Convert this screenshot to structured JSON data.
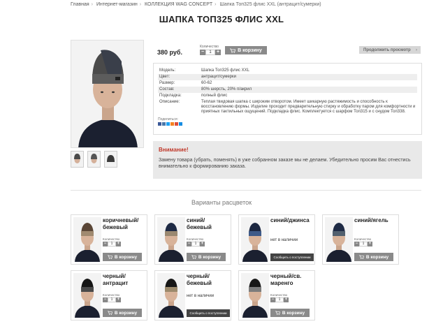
{
  "breadcrumb": [
    "Главная",
    "Интернет-магазин",
    "КОЛЛЕКЦИЯ WAG CONCEPT",
    "Шапка Топ325 флис XXL (антрацит/сумерки)"
  ],
  "title": "ШАПКА ТОП325 ФЛИС XXL",
  "price": "380 руб.",
  "quantity": {
    "label": "Количество",
    "value": "1",
    "minus": "−",
    "plus": "+"
  },
  "cart_label": "В корзину",
  "continue_label": "Продолжить просмотр",
  "specs": [
    {
      "k": "Модель:",
      "v": "Шапка Топ325 флис XXL"
    },
    {
      "k": "Цвет:",
      "v": "антрацит/сумерки"
    },
    {
      "k": "Размер:",
      "v": "60-62"
    },
    {
      "k": "Состав:",
      "v": "80% шерсть, 20% п/акрил"
    },
    {
      "k": "Подкладка:",
      "v": "полный флис"
    },
    {
      "k": "Описание:",
      "v": "Теплая твидовая шапка с широким отворотом. Имеет шикарную растяжимость и способность к восстановлению формы. Изделие проходит предварительную стирку и обработку паром для комфортности и приятных тактильных ощущений. Подкладка флис. Комплектуется с шарфом Топ315 и с снудом Топ338."
    }
  ],
  "share_label": "Поделиться:",
  "social_colors": [
    "#3b5998",
    "#4a76a8",
    "#1da1f2",
    "#f58220",
    "#dd4b39",
    "#168de2"
  ],
  "notice": {
    "heading": "Внимание!",
    "text": "Замену товара (убрать, поменять) в уже собранном заказе мы не делаем. Убедительно просим Вас отнестись внимательно к формированию заказа."
  },
  "variants_title": "Варианты расцветок",
  "variants": [
    {
      "name": "коричневый/ бежевый",
      "available": true,
      "hat": "#5a4636",
      "band": "#a08a70"
    },
    {
      "name": "синий/ бежевый",
      "available": true,
      "hat": "#1e2a44",
      "band": "#9a8870"
    },
    {
      "name": "синий/джинса",
      "available": false,
      "hat": "#1c2740",
      "band": "#3e5a88"
    },
    {
      "name": "синий/ягель",
      "available": true,
      "hat": "#1f2b45",
      "band": "#52606e"
    },
    {
      "name": "черный/ антрацит",
      "available": true,
      "hat": "#161616",
      "band": "#4a4a4a"
    },
    {
      "name": "черный/ бежевый",
      "available": false,
      "hat": "#171717",
      "band": "#9c8a6c"
    },
    {
      "name": "черный/св. маренго",
      "available": true,
      "hat": "#181818",
      "band": "#7c7c7c"
    }
  ],
  "not_available_label": "нет в наличии",
  "notify_label": "Сообщить о поступлении"
}
